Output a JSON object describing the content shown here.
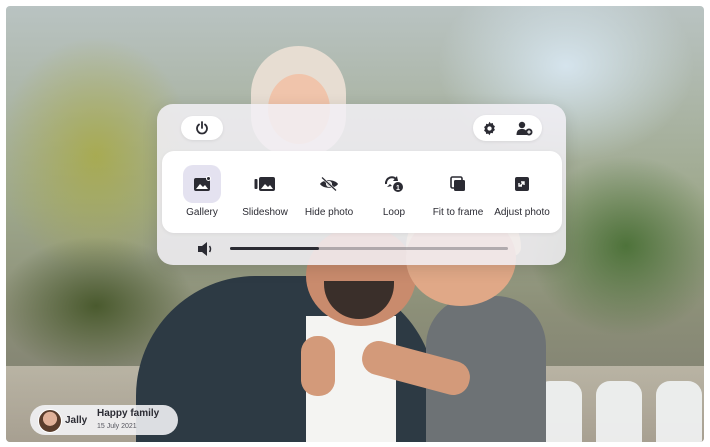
{
  "panel": {
    "power_icon": "power-icon",
    "settings_icon": "gear-icon",
    "add_user_icon": "add-user-icon"
  },
  "actions": [
    {
      "label": "Gallery",
      "icon": "gallery-icon",
      "active": true
    },
    {
      "label": "Slideshow",
      "icon": "slideshow-icon",
      "active": false
    },
    {
      "label": "Hide photo",
      "icon": "eye-off-icon",
      "active": false
    },
    {
      "label": "Loop",
      "icon": "loop-icon",
      "active": false
    },
    {
      "label": "Fit to frame",
      "icon": "fit-to-frame-icon",
      "active": false
    },
    {
      "label": "Adjust photo",
      "icon": "adjust-photo-icon",
      "active": false
    }
  ],
  "volume": {
    "icon": "speaker-icon",
    "level": 0.32
  },
  "caption": {
    "user": "Jally",
    "title": "Happy family",
    "date": "15 July 2021"
  },
  "colors": {
    "accent": "#2b2b33",
    "active_bg": "#e4e2f0"
  }
}
